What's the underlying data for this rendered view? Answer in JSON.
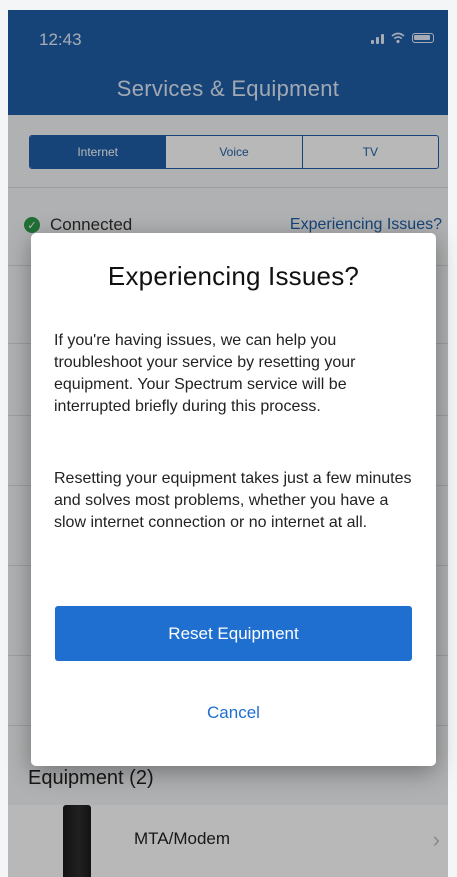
{
  "status_bar": {
    "time": "12:43",
    "icons": [
      "signal-icon",
      "wifi-icon",
      "battery-icon"
    ]
  },
  "header": {
    "title": "Services & Equipment"
  },
  "tabs": [
    {
      "label": "Internet",
      "active": true
    },
    {
      "label": "Voice",
      "active": false
    },
    {
      "label": "TV",
      "active": false
    }
  ],
  "connection": {
    "status": "Connected",
    "issues_link": "Experiencing Issues?"
  },
  "equipment": {
    "header": "Equipment (2)",
    "items": [
      {
        "label": "MTA/Modem"
      }
    ]
  },
  "modal": {
    "title": "Experiencing Issues?",
    "paragraph1": "If you're having issues, we can help you troubleshoot your service by resetting your equipment. Your Spectrum service will be interrupted briefly during this process.",
    "paragraph2": "Resetting your equipment takes just a few minutes and solves most problems, whether you have a slow internet connection or no internet at all.",
    "primary_button": "Reset Equipment",
    "secondary_button": "Cancel"
  },
  "colors": {
    "brand_blue": "#1f5fa8",
    "button_blue": "#1f6fd0",
    "success_green": "#2e9b4a"
  }
}
